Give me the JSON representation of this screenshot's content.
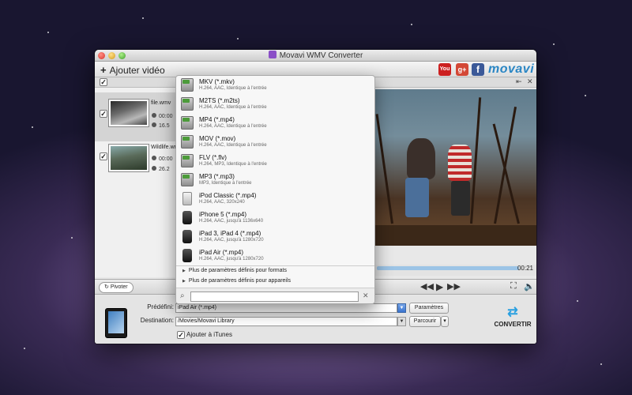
{
  "window": {
    "title": "Movavi WMV Converter"
  },
  "toolbar": {
    "add_label": "Ajouter vidéo",
    "social": {
      "youtube": "You Tube",
      "gplus": "g+",
      "facebook": "f"
    },
    "logo": "movavi"
  },
  "files": [
    {
      "name": "file.wmv",
      "duration": "00:00",
      "size": "16.5",
      "checked": true
    },
    {
      "name": "Wildlife.wm",
      "duration": "00:00",
      "size": "26.2",
      "checked": true
    }
  ],
  "format_menu": {
    "items": [
      {
        "title": "MKV (*.mkv)",
        "subtitle": "H.264, AAC, Identique à l'entrée",
        "icon": "mkv-format-icon"
      },
      {
        "title": "M2TS (*.m2ts)",
        "subtitle": "H.264, AAC, Identique à l'entrée",
        "icon": "m2ts-format-icon"
      },
      {
        "title": "MP4 (*.mp4)",
        "subtitle": "H.264, AAC, Identique à l'entrée",
        "icon": "mp4-format-icon"
      },
      {
        "title": "MOV (*.mov)",
        "subtitle": "H.264, AAC, Identique à l'entrée",
        "icon": "mov-format-icon"
      },
      {
        "title": "FLV (*.flv)",
        "subtitle": "H.264, MP3, Identique à l'entrée",
        "icon": "flv-format-icon"
      },
      {
        "title": "MP3 (*.mp3)",
        "subtitle": "MP3, Identique à l'entrée",
        "icon": "mp3-format-icon"
      },
      {
        "title": "iPod Classic (*.mp4)",
        "subtitle": "H.264, AAC, 320x240",
        "icon": "ipod-classic-icon"
      },
      {
        "title": "iPhone 5 (*.mp4)",
        "subtitle": "H.264, AAC, jusqu'à 1136x640",
        "icon": "iphone-icon"
      },
      {
        "title": "iPad 3, iPad 4 (*.mp4)",
        "subtitle": "H.264, AAC, jusqu'à 1280x720",
        "icon": "ipad-icon"
      },
      {
        "title": "iPad Air (*.mp4)",
        "subtitle": "H.264, AAC, jusqu'à 1280x720",
        "icon": "ipad-air-icon"
      }
    ],
    "more_formats": "Plus de paramètres définis pour formats",
    "more_devices": "Plus de paramètres définis pour appareils",
    "search_placeholder": ""
  },
  "player": {
    "time": "00:21",
    "rotate_label": "Pivoter"
  },
  "settings": {
    "preset_label": "Prédéfini:",
    "preset_value": "iPad Air (*.mp4)",
    "params_button": "Paramètres",
    "destination_label": "Destination:",
    "destination_value": "/Movies/Movavi Library",
    "browse_button": "Parcourir",
    "itunes_label": "Ajouter à iTunes",
    "itunes_checked": true,
    "convert_label": "CONVERTIR"
  }
}
